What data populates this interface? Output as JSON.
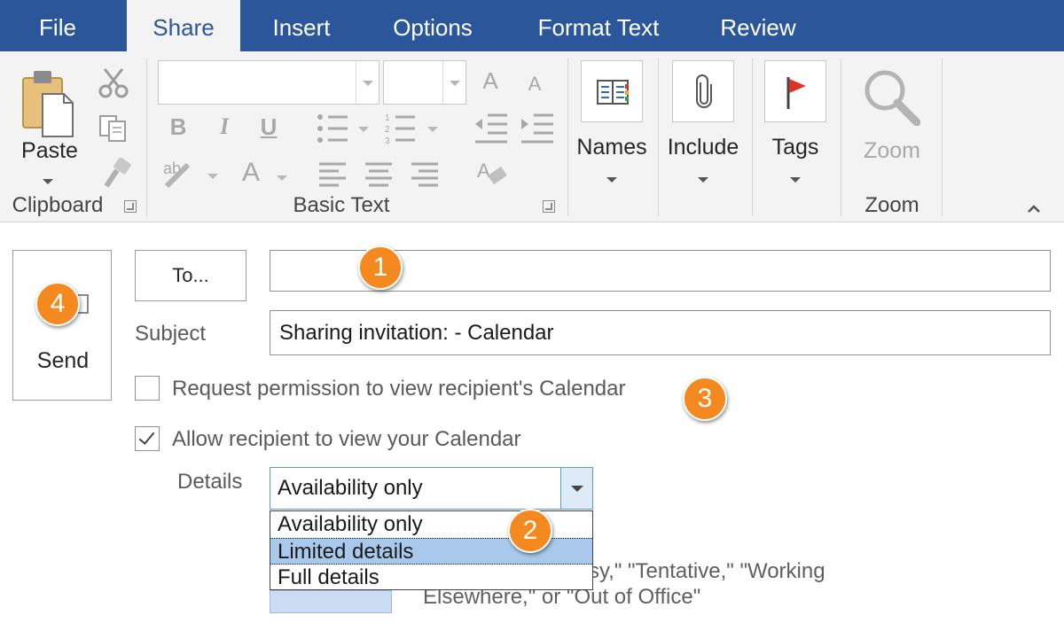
{
  "tabs": [
    {
      "label": "File",
      "active": false
    },
    {
      "label": "Share",
      "active": true
    },
    {
      "label": "Insert",
      "active": false
    },
    {
      "label": "Options",
      "active": false
    },
    {
      "label": "Format Text",
      "active": false
    },
    {
      "label": "Review",
      "active": false
    }
  ],
  "ribbon": {
    "clipboard": {
      "group_label": "Clipboard",
      "paste_label": "Paste"
    },
    "basic_text": {
      "group_label": "Basic Text",
      "font_name_value": "",
      "font_size_value": ""
    },
    "names": {
      "label": "Names"
    },
    "include": {
      "label": "Include"
    },
    "tags": {
      "label": "Tags"
    },
    "zoom": {
      "button_label": "Zoom",
      "group_label": "Zoom"
    }
  },
  "form": {
    "send_label": "Send",
    "to_button_label": "To...",
    "to_value": "",
    "subject_label": "Subject",
    "subject_value": "Sharing invitation:  - Calendar",
    "request_permission": {
      "label": "Request permission to view recipient's Calendar",
      "checked": false
    },
    "allow_view": {
      "label": "Allow recipient to view your Calendar",
      "checked": true
    },
    "details": {
      "label": "Details",
      "selected": "Availability only",
      "options": [
        "Availability only",
        "Limited details",
        "Full details"
      ],
      "highlighted_index": 1
    },
    "description_line1": "wn as \"Free,\" \"Busy,\" \"Tentative,\" \"Working",
    "description_line2": "Elsewhere,\" or \"Out of Office\""
  },
  "callouts": [
    "1",
    "2",
    "3",
    "4"
  ],
  "colors": {
    "accent": "#2b579a",
    "callout": "#f48a1f",
    "highlight": "#a9c9ec",
    "flag": "#d9342b"
  },
  "icons": [
    "scissors-icon",
    "copy-icon",
    "format-painter-icon",
    "paste-icon",
    "address-book-icon",
    "paperclip-icon",
    "flag-icon",
    "magnifier-icon"
  ]
}
